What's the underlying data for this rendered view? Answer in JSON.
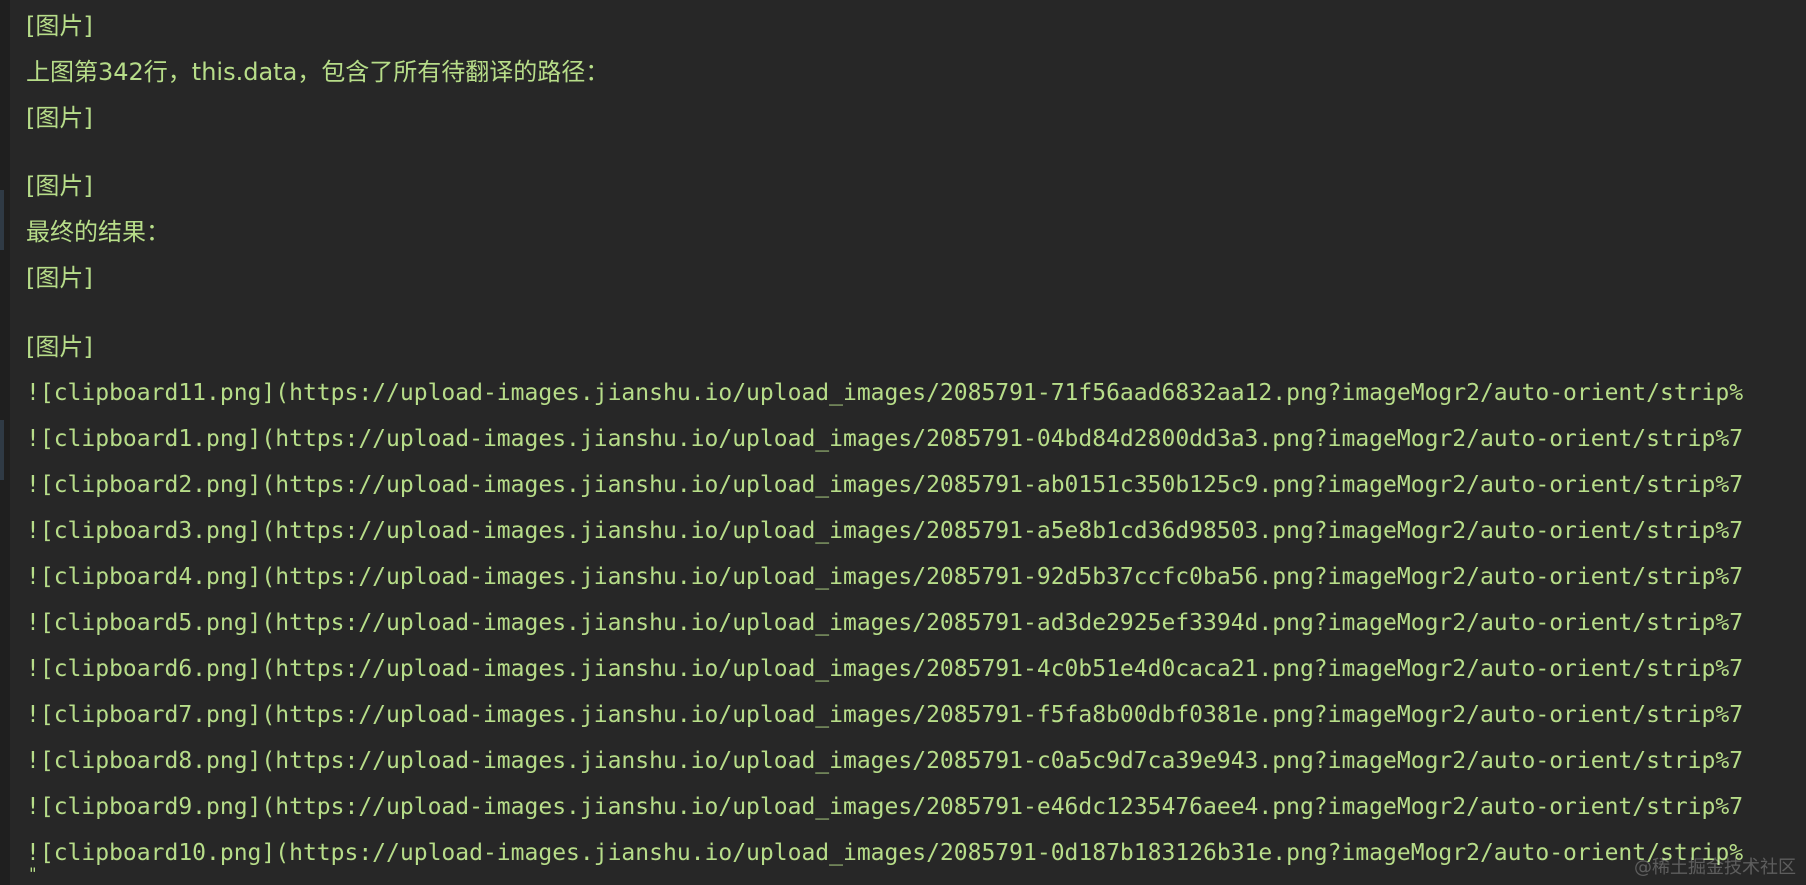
{
  "editor": {
    "lines": [
      "[图片]",
      "上图第342行，this.data，包含了所有待翻译的路径：",
      "[图片]",
      "[图片]",
      "最终的结果：",
      "[图片]",
      "[图片]",
      "![clipboard11.png](https://upload-images.jianshu.io/upload_images/2085791-71f56aad6832aa12.png?imageMogr2/auto-orient/strip%",
      "![clipboard1.png](https://upload-images.jianshu.io/upload_images/2085791-04bd84d2800dd3a3.png?imageMogr2/auto-orient/strip%7",
      "![clipboard2.png](https://upload-images.jianshu.io/upload_images/2085791-ab0151c350b125c9.png?imageMogr2/auto-orient/strip%7",
      "![clipboard3.png](https://upload-images.jianshu.io/upload_images/2085791-a5e8b1cd36d98503.png?imageMogr2/auto-orient/strip%7",
      "![clipboard4.png](https://upload-images.jianshu.io/upload_images/2085791-92d5b37ccfc0ba56.png?imageMogr2/auto-orient/strip%7",
      "![clipboard5.png](https://upload-images.jianshu.io/upload_images/2085791-ad3de2925ef3394d.png?imageMogr2/auto-orient/strip%7",
      "![clipboard6.png](https://upload-images.jianshu.io/upload_images/2085791-4c0b51e4d0caca21.png?imageMogr2/auto-orient/strip%7",
      "![clipboard7.png](https://upload-images.jianshu.io/upload_images/2085791-f5fa8b00dbf0381e.png?imageMogr2/auto-orient/strip%7",
      "![clipboard8.png](https://upload-images.jianshu.io/upload_images/2085791-c0a5c9d7ca39e943.png?imageMogr2/auto-orient/strip%7",
      "![clipboard9.png](https://upload-images.jianshu.io/upload_images/2085791-e46dc1235476aee4.png?imageMogr2/auto-orient/strip%7",
      "![clipboard10.png](https://upload-images.jianshu.io/upload_images/2085791-0d187b183126b31e.png?imageMogr2/auto-orient/strip%"
    ]
  },
  "watermark": "@稀土掘金技术社区",
  "colors": {
    "background": "#272727",
    "text": "#b7dd89"
  }
}
